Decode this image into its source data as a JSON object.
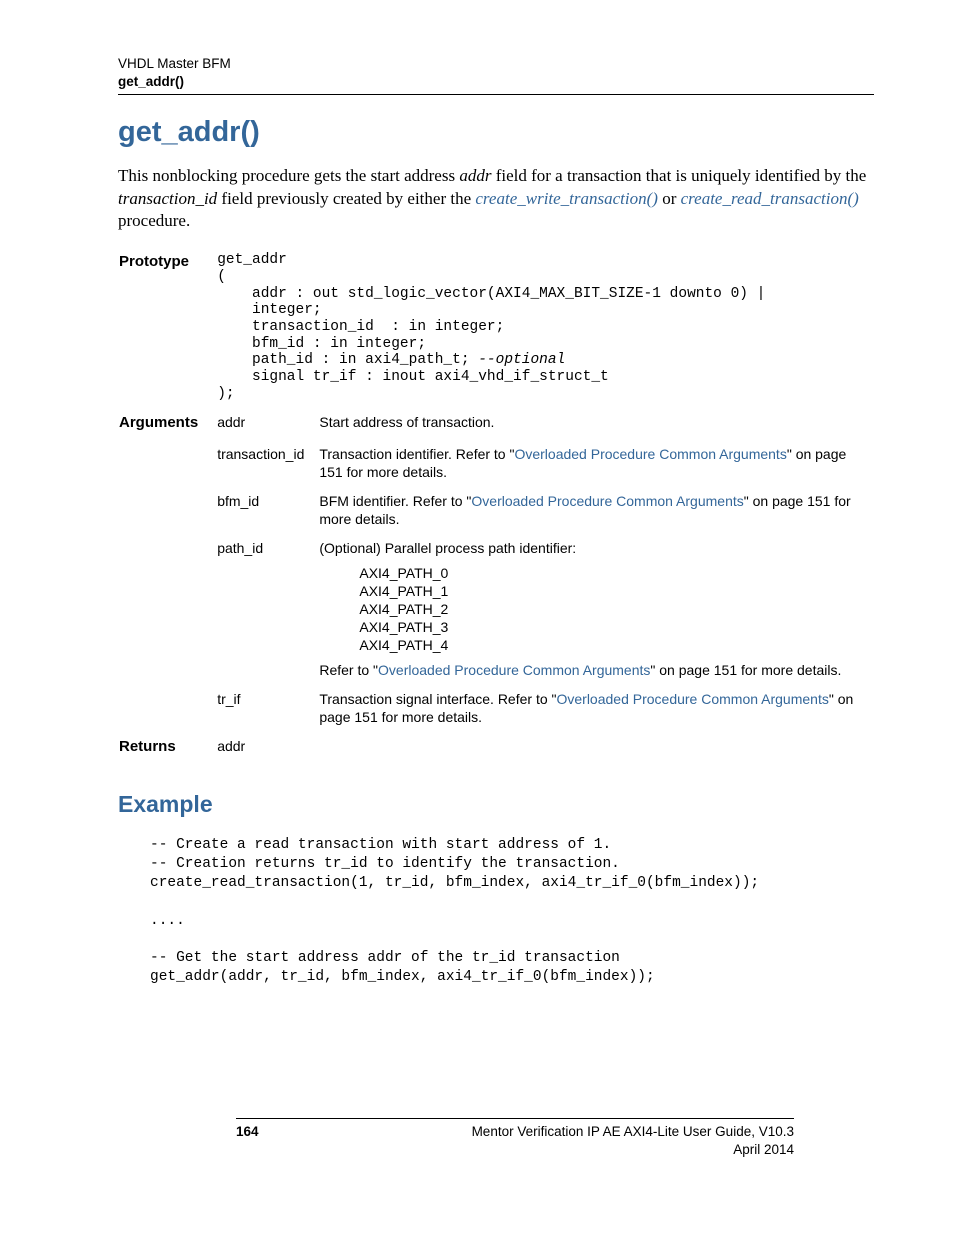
{
  "header": {
    "line1": "VHDL Master BFM",
    "line2": "get_addr()"
  },
  "title": "get_addr()",
  "intro": {
    "pre": "This nonblocking procedure gets the start address ",
    "addr_ital": "addr",
    "mid1": " field for a transaction that is uniquely identified by the ",
    "txn_ital": "transaction_id",
    "mid2": " field previously created by either the ",
    "link1": "create_write_transaction()",
    "or_txt": " or ",
    "link2": "create_read_transaction()",
    "post": " procedure."
  },
  "labels": {
    "prototype": "Prototype",
    "arguments": "Arguments",
    "returns": "Returns"
  },
  "prototype": {
    "l1": "get_addr",
    "l2": "(",
    "l3": "    addr : out std_logic_vector(AXI4_MAX_BIT_SIZE-1 downto 0) |",
    "l4": "    integer;",
    "l5": "    transaction_id  : in integer;",
    "l6": "    bfm_id : in integer;",
    "l7a": "    path_id : in axi4_path_t; ",
    "l7b": "--optional",
    "l8": "    signal tr_if : inout axi4_vhd_if_struct_t",
    "l9": ");"
  },
  "arguments": [
    {
      "name": "addr",
      "desc_pre": "Start address of transaction.",
      "has_link": false
    },
    {
      "name": "transaction_id",
      "desc_pre": "Transaction identifier. Refer to \"",
      "link": "Overloaded Procedure Common Arguments",
      "desc_post": "\" on page 151 for more details.",
      "has_link": true
    },
    {
      "name": "bfm_id",
      "desc_pre": "BFM identifier. Refer to \"",
      "link": "Overloaded Procedure Common Arguments",
      "desc_post": "\" on page 151 for more details.",
      "has_link": true
    }
  ],
  "path_id_arg": {
    "name": "path_id",
    "intro": "(Optional) Parallel process path identifier:",
    "paths": [
      "AXI4_PATH_0",
      "AXI4_PATH_1",
      "AXI4_PATH_2",
      "AXI4_PATH_3",
      "AXI4_PATH_4"
    ],
    "tail_pre": "Refer to \"",
    "tail_link": "Overloaded Procedure Common Arguments",
    "tail_post": "\" on page 151 for more details."
  },
  "tr_if_arg": {
    "name": "tr_if",
    "desc_pre": "Transaction signal interface. Refer to \"",
    "link": "Overloaded Procedure Common Arguments",
    "desc_post": "\" on page 151 for more details."
  },
  "returns_val": "addr",
  "example_heading": "Example",
  "example_code": "-- Create a read transaction with start address of 1.\n-- Creation returns tr_id to identify the transaction.\ncreate_read_transaction(1, tr_id, bfm_index, axi4_tr_if_0(bfm_index));\n\n....\n\n-- Get the start address addr of the tr_id transaction\nget_addr(addr, tr_id, bfm_index, axi4_tr_if_0(bfm_index));",
  "footer": {
    "page": "164",
    "doc": "Mentor Verification IP AE AXI4-Lite User Guide, V10.3",
    "date": "April 2014"
  }
}
